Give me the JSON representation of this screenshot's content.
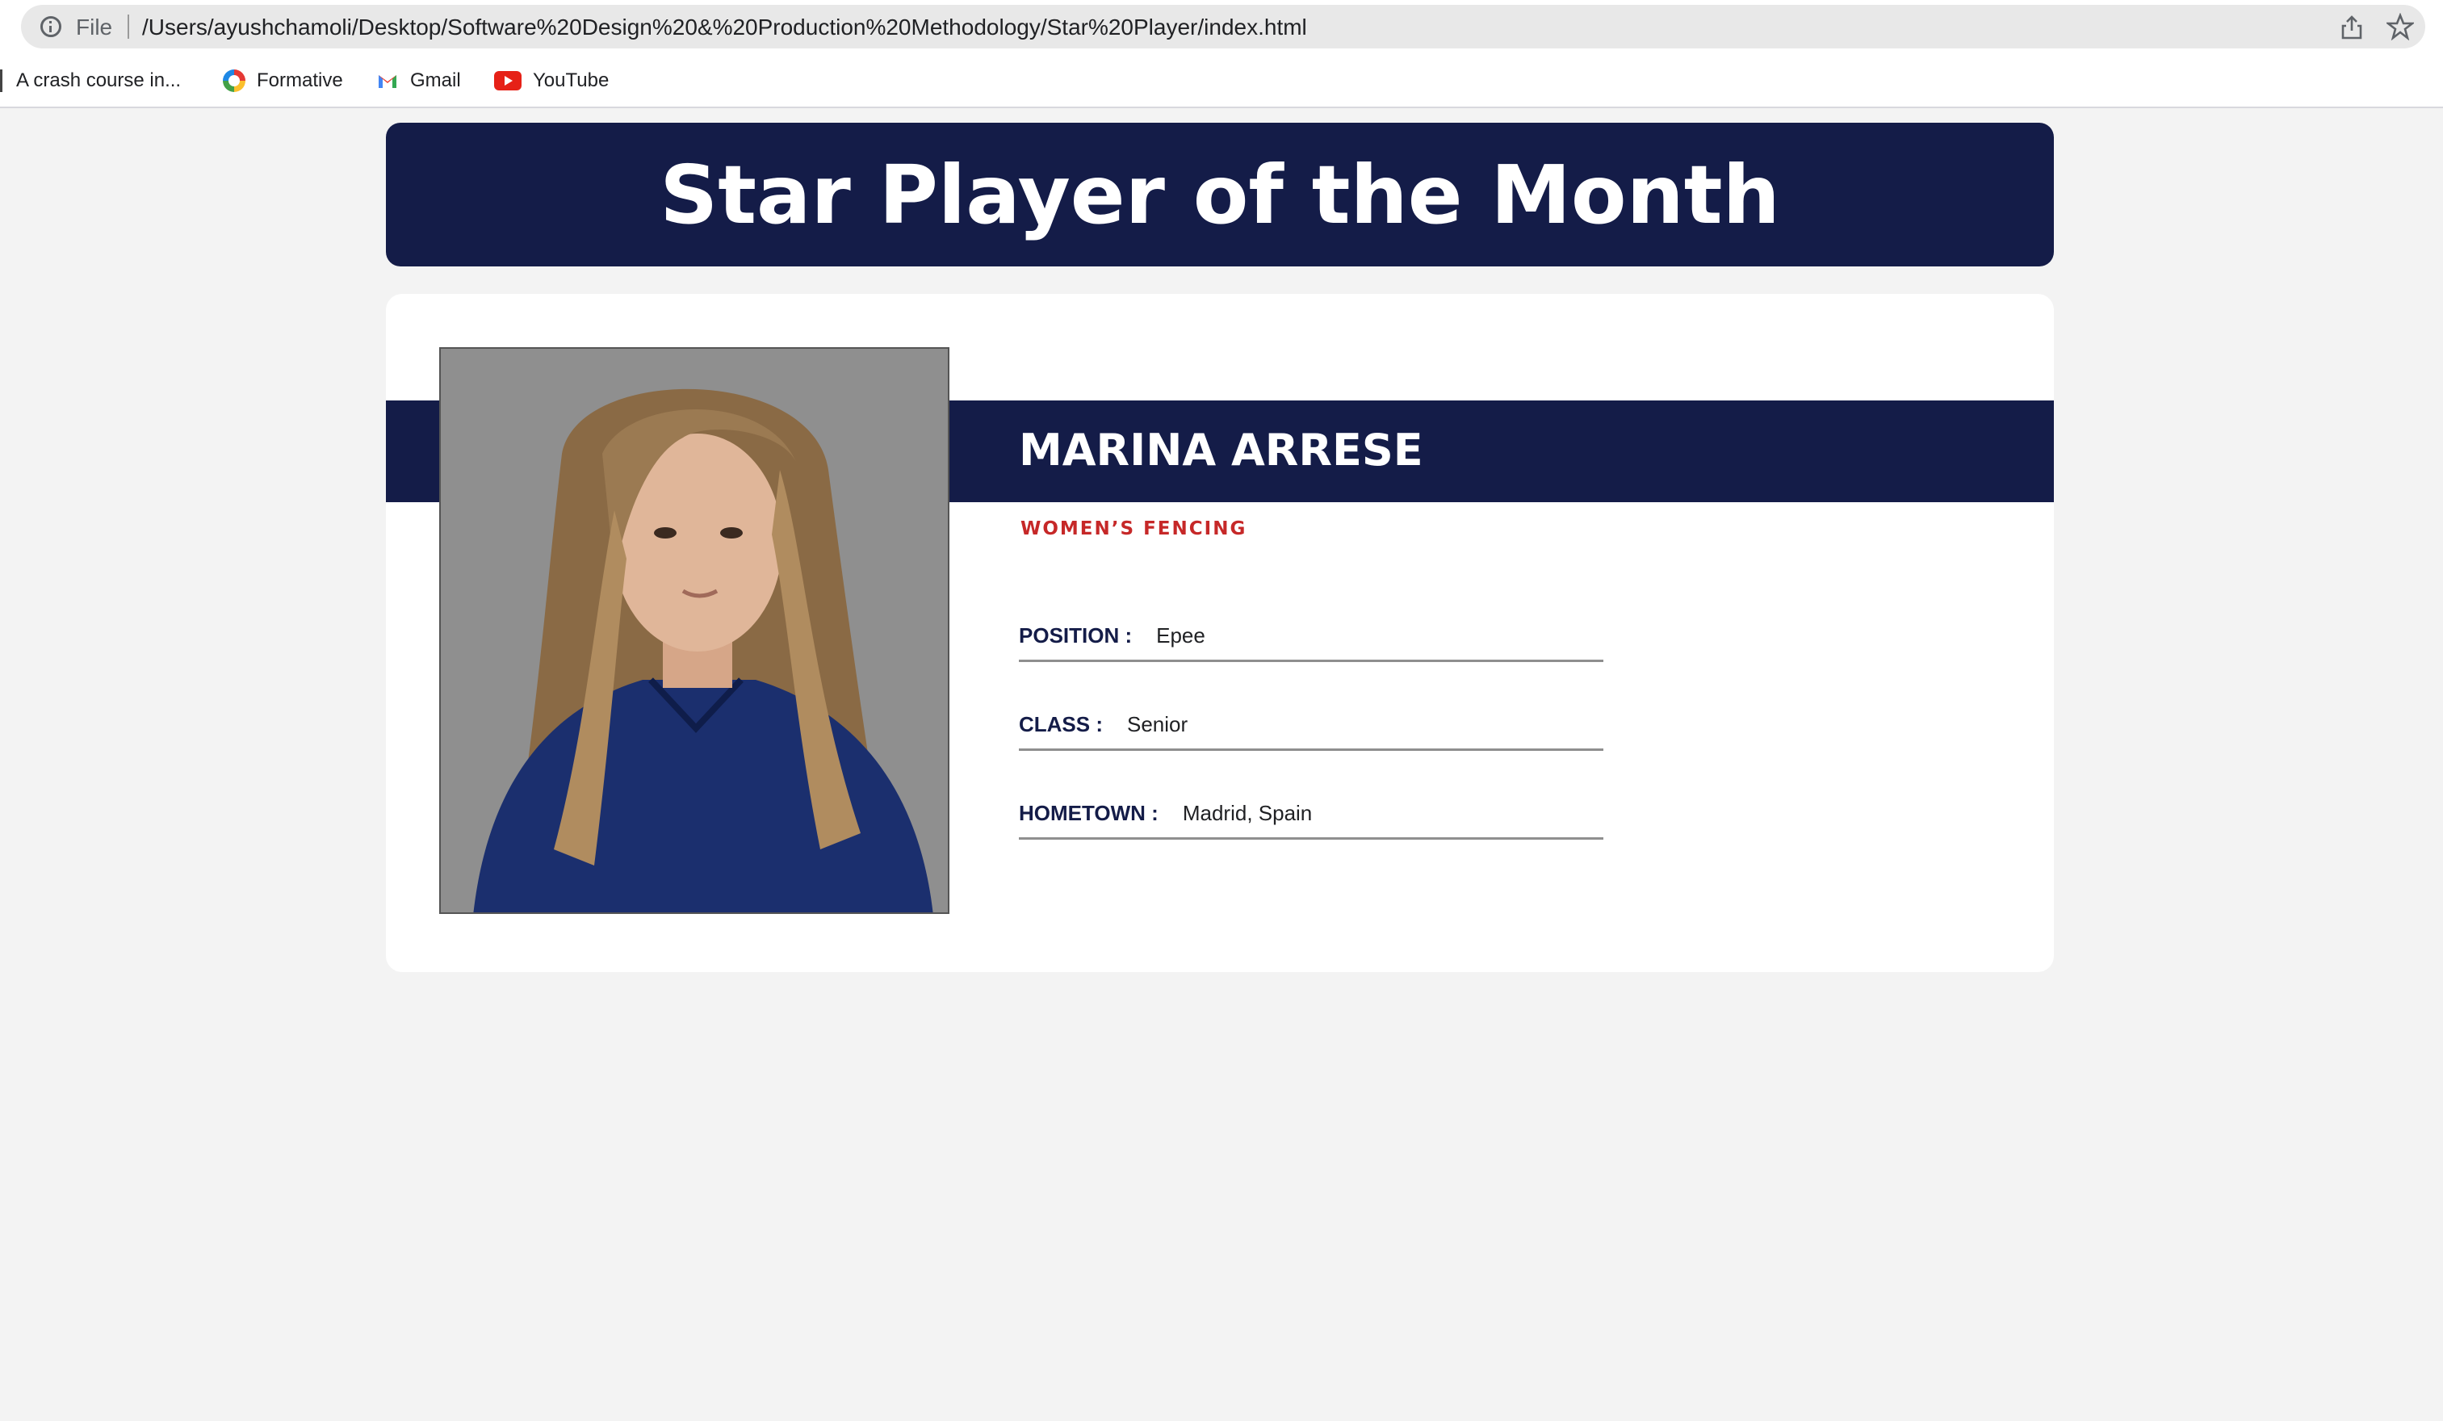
{
  "browser": {
    "scheme": "File",
    "url": "/Users/ayushchamoli/Desktop/Software%20Design%20&%20Production%20Methodology/Star%20Player/index.html",
    "bookmarks": [
      {
        "label": "A crash course in...",
        "icon": "document-icon"
      },
      {
        "label": "Formative",
        "icon": "formative-icon"
      },
      {
        "label": "Gmail",
        "icon": "gmail-icon"
      },
      {
        "label": "YouTube",
        "icon": "youtube-icon"
      }
    ]
  },
  "page": {
    "title": "Star Player of the Month"
  },
  "player": {
    "name": "MARINA ARRESE",
    "team": "WOMEN’S FENCING",
    "fields": [
      {
        "label": "POSITION :",
        "value": "Epee"
      },
      {
        "label": "CLASS :",
        "value": "Senior"
      },
      {
        "label": "HOMETOWN :",
        "value": "Madrid, Spain"
      }
    ]
  },
  "colors": {
    "navy": "#141c48",
    "accent_red": "#c62828",
    "page_bg": "#f3f3f3"
  }
}
